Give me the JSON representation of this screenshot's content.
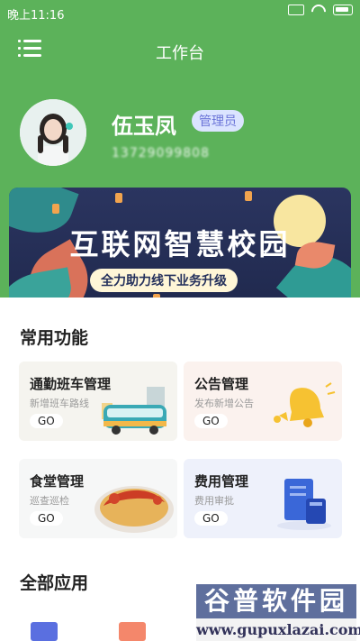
{
  "status_bar": {
    "time": "晚上11:16"
  },
  "header": {
    "title": "工作台"
  },
  "profile": {
    "name": "伍玉凤",
    "role": "管理员",
    "phone": "13729099808"
  },
  "banner": {
    "title": "互联网智慧校园",
    "subtitle": "全力助力线下业务升级"
  },
  "common": {
    "heading": "常用功能",
    "cards": [
      {
        "title": "通勤班车管理",
        "subtitle": "新增班车路线",
        "go": "GO"
      },
      {
        "title": "公告管理",
        "subtitle": "发布新增公告",
        "go": "GO"
      },
      {
        "title": "食堂管理",
        "subtitle": "巡查巡检",
        "go": "GO"
      },
      {
        "title": "费用管理",
        "subtitle": "费用审批",
        "go": "GO"
      }
    ]
  },
  "all_apps": {
    "heading": "全部应用"
  },
  "watermark": {
    "brand": "谷普软件园",
    "url": "www.gupuxlazai.com"
  },
  "colors": {
    "header_green": "#5cb25a",
    "role_badge": "#dbe4ff",
    "banner_dark": "#24305c"
  }
}
